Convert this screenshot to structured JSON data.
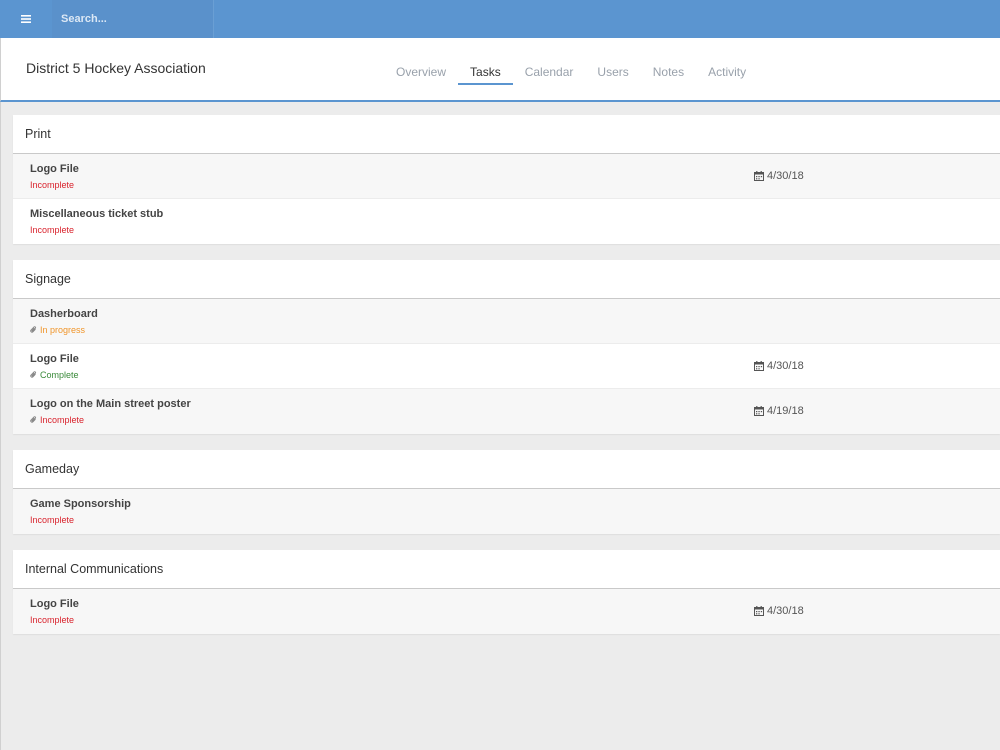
{
  "topbar": {
    "menu_icon": "hamburger-menu-icon",
    "search_placeholder": "Search..."
  },
  "header": {
    "org_name": "District 5 Hockey Association",
    "tabs": [
      {
        "label": "Overview",
        "active": false
      },
      {
        "label": "Tasks",
        "active": true
      },
      {
        "label": "Calendar",
        "active": false
      },
      {
        "label": "Users",
        "active": false
      },
      {
        "label": "Notes",
        "active": false
      },
      {
        "label": "Activity",
        "active": false
      }
    ]
  },
  "colors": {
    "accent": "#5b95d0",
    "incomplete": "#d9232d",
    "in_progress": "#f0952a",
    "complete": "#3a8a3a"
  },
  "sections": [
    {
      "title": "Print",
      "tasks": [
        {
          "title": "Logo File",
          "status": "Incomplete",
          "status_type": "incomplete",
          "attachment": false,
          "date": "4/30/18"
        },
        {
          "title": "Miscellaneous ticket stub",
          "status": "Incomplete",
          "status_type": "incomplete",
          "attachment": false,
          "date": ""
        }
      ]
    },
    {
      "title": "Signage",
      "tasks": [
        {
          "title": "Dasherboard",
          "status": "In progress",
          "status_type": "progress",
          "attachment": true,
          "date": ""
        },
        {
          "title": "Logo File",
          "status": "Complete",
          "status_type": "complete",
          "attachment": true,
          "date": "4/30/18"
        },
        {
          "title": "Logo on the Main street poster",
          "status": "Incomplete",
          "status_type": "incomplete",
          "attachment": true,
          "date": "4/19/18"
        }
      ]
    },
    {
      "title": "Gameday",
      "tasks": [
        {
          "title": "Game Sponsorship",
          "status": "Incomplete",
          "status_type": "incomplete",
          "attachment": false,
          "date": ""
        }
      ]
    },
    {
      "title": "Internal Communications",
      "tasks": [
        {
          "title": "Logo File",
          "status": "Incomplete",
          "status_type": "incomplete",
          "attachment": false,
          "date": "4/30/18"
        }
      ]
    }
  ]
}
